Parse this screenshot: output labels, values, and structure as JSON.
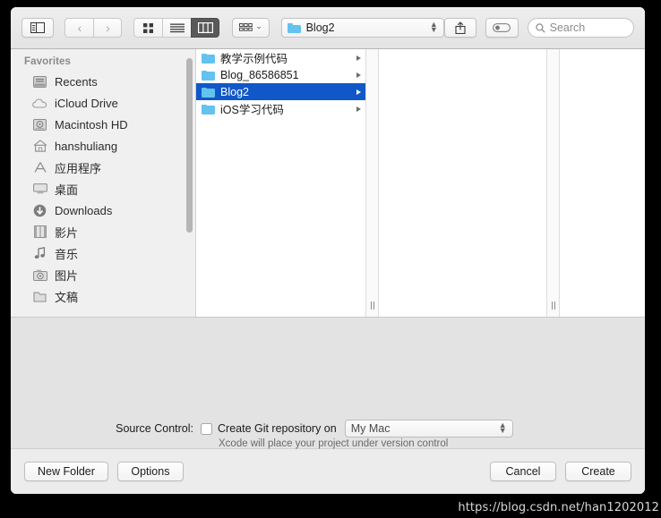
{
  "toolbar": {
    "sidebar_toggle_icon": "sidebar-toggle-icon",
    "back_label": "‹",
    "forward_label": "›",
    "view_modes": [
      {
        "name": "icon-view",
        "icon": "grid-icon",
        "active": false
      },
      {
        "name": "list-view",
        "icon": "list-icon",
        "active": false
      },
      {
        "name": "column-view",
        "icon": "columns-icon",
        "active": true
      }
    ],
    "arrange_icon": "arrange-grid-icon",
    "arrange_chevron": "⌄",
    "path_popup": {
      "label": "Blog2",
      "icon": "folder-icon"
    },
    "share_icon": "share-icon",
    "tag_icon": "tag-icon",
    "search": {
      "icon": "search-icon",
      "placeholder": "Search"
    }
  },
  "sidebar": {
    "header": "Favorites",
    "items": [
      {
        "label": "Recents",
        "icon": "recents-icon"
      },
      {
        "label": "iCloud Drive",
        "icon": "icloud-icon"
      },
      {
        "label": "Macintosh HD",
        "icon": "harddisk-icon"
      },
      {
        "label": "hanshuliang",
        "icon": "home-icon"
      },
      {
        "label": "应用程序",
        "icon": "applications-icon"
      },
      {
        "label": "桌面",
        "icon": "desktop-icon"
      },
      {
        "label": "Downloads",
        "icon": "downloads-icon"
      },
      {
        "label": "影片",
        "icon": "movies-icon"
      },
      {
        "label": "音乐",
        "icon": "music-icon"
      },
      {
        "label": "图片",
        "icon": "pictures-icon"
      },
      {
        "label": "文稿",
        "icon": "documents-icon"
      }
    ]
  },
  "browser": {
    "column1": [
      {
        "name": "教学示例代码",
        "selected": false,
        "has_children": true
      },
      {
        "name": "Blog_86586851",
        "selected": false,
        "has_children": true
      },
      {
        "name": "Blog2",
        "selected": true,
        "has_children": true
      },
      {
        "name": "iOS学习代码",
        "selected": false,
        "has_children": true
      }
    ],
    "column2": [],
    "column3": []
  },
  "accessory": {
    "source_control_label": "Source Control:",
    "checkbox_checked": false,
    "checkbox_label": "Create Git repository on",
    "remote_selected": "My Mac",
    "hint": "Xcode will place your project under version control"
  },
  "footer": {
    "new_folder": "New Folder",
    "options": "Options",
    "cancel": "Cancel",
    "create": "Create"
  },
  "watermark": "https://blog.csdn.net/han1202012",
  "colors": {
    "selection_blue": "#1058c8",
    "folder_blue": "#63c2ee",
    "panel_gray": "#e3e3e3"
  }
}
